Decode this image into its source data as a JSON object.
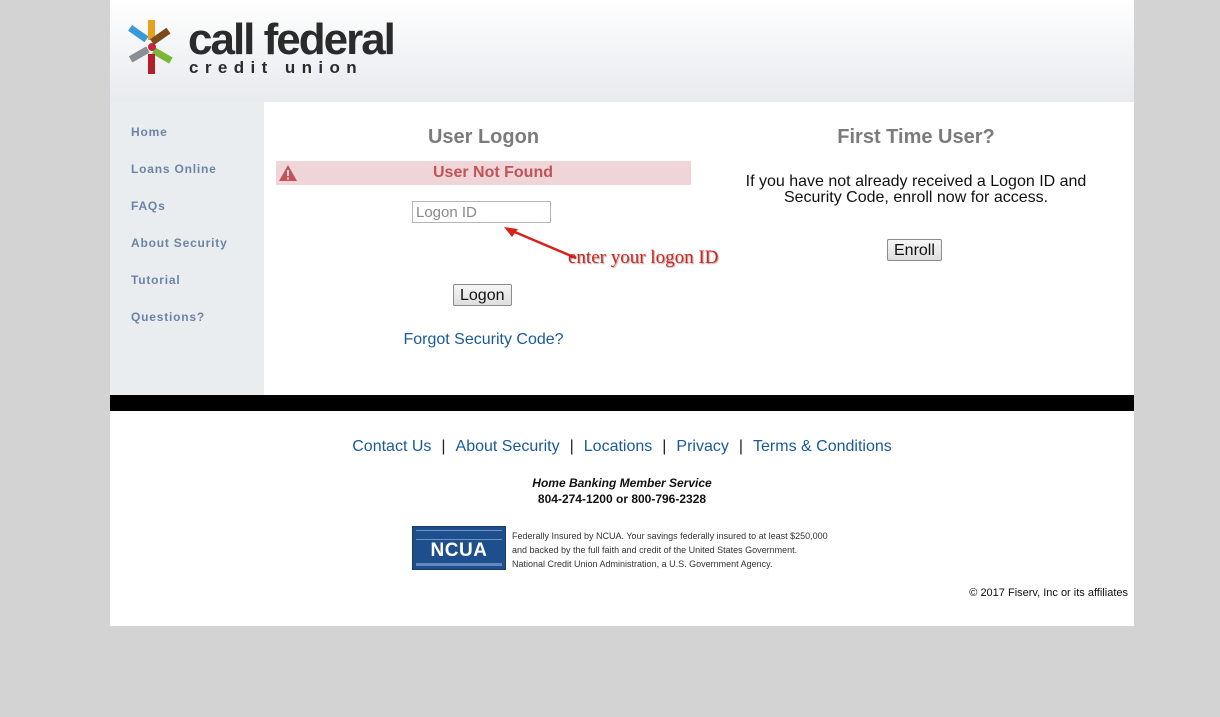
{
  "brand": {
    "name_line1": "call federal",
    "name_line2": "credit union"
  },
  "sidebar": {
    "items": [
      {
        "label": "Home"
      },
      {
        "label": "Loans Online"
      },
      {
        "label": "FAQs"
      },
      {
        "label": "About Security"
      },
      {
        "label": "Tutorial"
      },
      {
        "label": "Questions?"
      }
    ]
  },
  "logon": {
    "title": "User Logon",
    "error": "User Not Found",
    "input_placeholder": "Logon ID",
    "input_value": "",
    "annotation": "enter your logon ID",
    "button": "Logon",
    "forgot_link": "Forgot Security Code?"
  },
  "first_time": {
    "title": "First Time User?",
    "text": "If you have not already received a Logon ID and Security Code, enroll now for access.",
    "button": "Enroll"
  },
  "footer": {
    "links": [
      "Contact Us",
      "About Security",
      "Locations",
      "Privacy",
      "Terms & Conditions"
    ],
    "separator": "|",
    "service_title": "Home Banking Member Service",
    "service_phone": "804-274-1200 or 800-796-2328",
    "ncua_label": "NCUA",
    "ncua_line1": "Federally Insured by NCUA. Your savings federally insured to at least $250,000",
    "ncua_line2": "and backed by the full faith and credit of the United States Government.",
    "ncua_line3": "National Credit Union Administration, a U.S. Government Agency.",
    "copyright": "© 2017 Fiserv, Inc or its affiliates"
  },
  "colors": {
    "nav_text": "#6c84a3",
    "error_bg": "#f0d5d8",
    "error_text": "#c0545a",
    "link": "#1a5a9b",
    "annotation": "#d8231d",
    "ncua_blue": "#1f4e8c"
  },
  "icons": {
    "logo": "starburst-logo-icon",
    "error": "warning-triangle-icon",
    "annotation": "red-arrow-icon"
  }
}
